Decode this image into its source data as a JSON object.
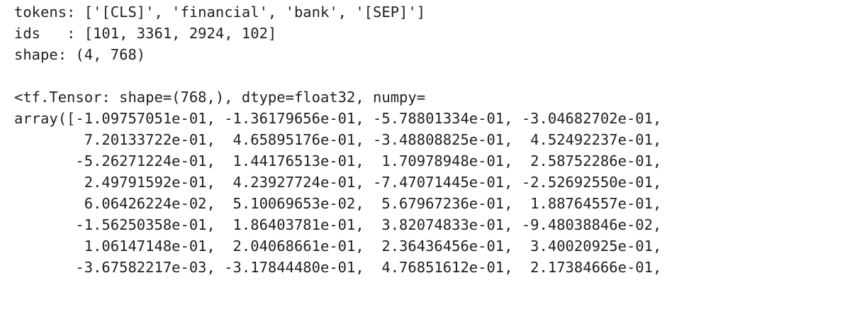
{
  "output": {
    "lines": [
      "tokens: ['[CLS]', 'financial', 'bank', '[SEP]']",
      "ids   : [101, 3361, 2924, 102]",
      "shape: (4, 768)",
      "",
      "<tf.Tensor: shape=(768,), dtype=float32, numpy=",
      "array([-1.09757051e-01, -1.36179656e-01, -5.78801334e-01, -3.04682702e-01,",
      "        7.20133722e-01,  4.65895176e-01, -3.48808825e-01,  4.52492237e-01,",
      "       -5.26271224e-01,  1.44176513e-01,  1.70978948e-01,  2.58752286e-01,",
      "        2.49791592e-01,  4.23927724e-01, -7.47071445e-01, -2.52692550e-01,",
      "        6.06426224e-02,  5.10069653e-02,  5.67967236e-01,  1.88764557e-01,",
      "       -1.56250358e-01,  1.86403781e-01,  3.82074833e-01, -9.48038846e-02,",
      "        1.06147148e-01,  2.04068661e-01,  2.36436456e-01,  3.40020925e-01,",
      "       -3.67582217e-03, -3.17844480e-01,  4.76851612e-01,  2.17384666e-01,"
    ]
  }
}
